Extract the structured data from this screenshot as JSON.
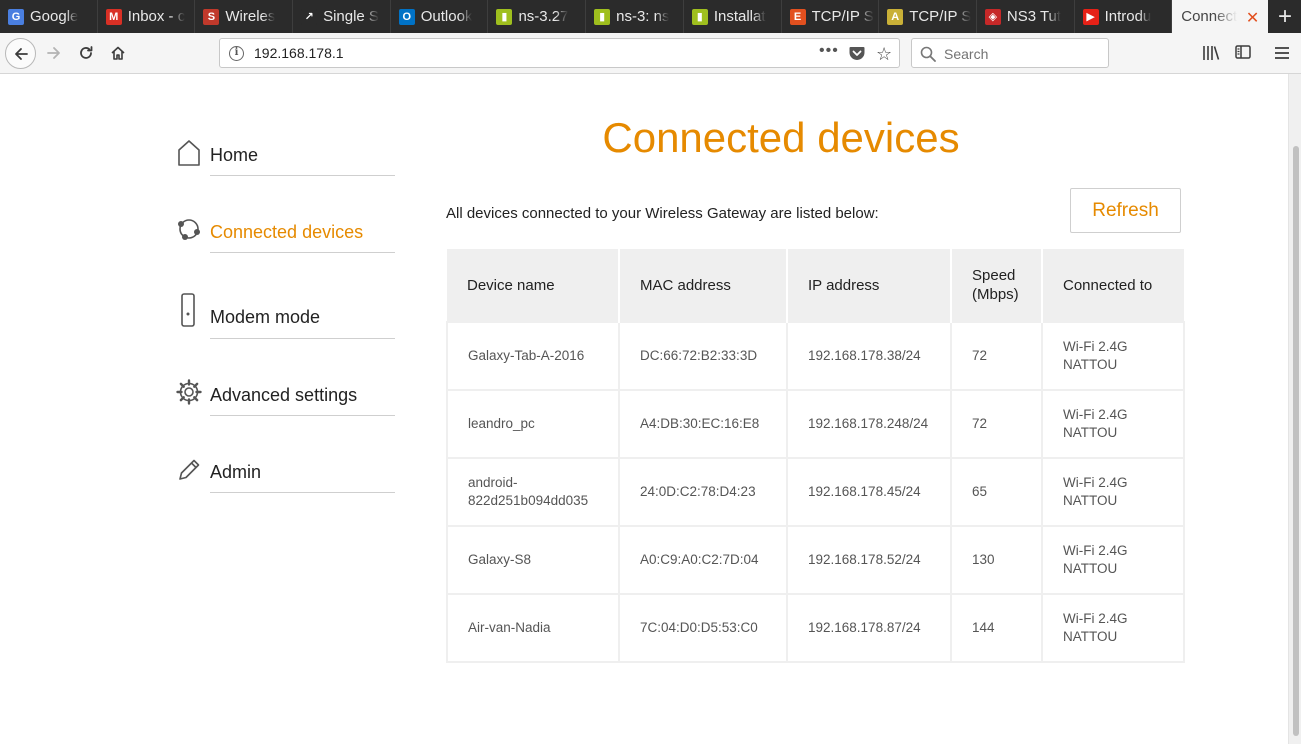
{
  "browser": {
    "tabs": [
      {
        "title": "Google",
        "favicon": "google-translate-icon",
        "color": "#4a7fe0",
        "glyph": "G"
      },
      {
        "title": "Inbox - c",
        "favicon": "gmail-icon",
        "color": "#d93025",
        "glyph": "M"
      },
      {
        "title": "Wireles",
        "favicon": "slideshare-icon",
        "color": "#c0392b",
        "glyph": "S"
      },
      {
        "title": "Single S",
        "favicon": "bird-icon",
        "color": "#2b2b2b",
        "glyph": "↗"
      },
      {
        "title": "Outlook",
        "favicon": "outlook-icon",
        "color": "#0072c6",
        "glyph": "O"
      },
      {
        "title": "ns-3.27",
        "favicon": "ns3-icon",
        "color": "#9fbf1e",
        "glyph": "▮"
      },
      {
        "title": "ns-3: ns",
        "favicon": "ns3-icon",
        "color": "#9fbf1e",
        "glyph": "▮"
      },
      {
        "title": "Installat",
        "favicon": "ns3-icon",
        "color": "#9fbf1e",
        "glyph": "▮"
      },
      {
        "title": "TCP/IP S",
        "favicon": "e-letter-icon",
        "color": "#e2501f",
        "glyph": "E"
      },
      {
        "title": "TCP/IP S",
        "favicon": "a-letter-icon",
        "color": "#c9b037",
        "glyph": "A"
      },
      {
        "title": "NS3 Tut",
        "favicon": "shield-icon",
        "color": "#c62828",
        "glyph": "◈"
      },
      {
        "title": "Introdu",
        "favicon": "youtube-icon",
        "color": "#e62117",
        "glyph": "▶"
      }
    ],
    "active_tab": {
      "title": "Connect",
      "close_glyph": "✕"
    },
    "new_tab_glyph": "+",
    "url": "192.168.178.1",
    "url_info_glyph": "i",
    "url_more_glyph": "•••",
    "bookmark_glyph": "☆",
    "search_placeholder": "Search"
  },
  "sidebar": {
    "items": [
      {
        "label": "Home",
        "icon": "home-icon",
        "active": false
      },
      {
        "label": "Connected devices",
        "icon": "devices-network-icon",
        "active": true
      },
      {
        "label": "Modem mode",
        "icon": "modem-icon",
        "active": false
      },
      {
        "label": "Advanced settings",
        "icon": "gear-icon",
        "active": false
      },
      {
        "label": "Admin",
        "icon": "pencil-icon",
        "active": false
      }
    ]
  },
  "main": {
    "title": "Connected devices",
    "intro": "All devices connected to your Wireless Gateway are listed below:",
    "refresh_label": "Refresh",
    "accent_color": "#e68a00"
  },
  "table": {
    "headers": [
      "Device name",
      "MAC address",
      "IP address",
      "Speed\n(Mbps)",
      "Connected to"
    ],
    "rows": [
      {
        "name": "Galaxy-Tab-A-2016",
        "mac": "DC:66:72:B2:33:3D",
        "ip": "192.168.178.38/24",
        "speed": "72",
        "connected": "Wi-Fi 2.4G\nNATTOU"
      },
      {
        "name": "leandro_pc",
        "mac": "A4:DB:30:EC:16:E8",
        "ip": "192.168.178.248/24",
        "speed": "72",
        "connected": "Wi-Fi 2.4G\nNATTOU"
      },
      {
        "name": "android-\n822d251b094dd035",
        "mac": "24:0D:C2:78:D4:23",
        "ip": "192.168.178.45/24",
        "speed": "65",
        "connected": "Wi-Fi 2.4G\nNATTOU"
      },
      {
        "name": "Galaxy-S8",
        "mac": "A0:C9:A0:C2:7D:04",
        "ip": "192.168.178.52/24",
        "speed": "130",
        "connected": "Wi-Fi 2.4G\nNATTOU"
      },
      {
        "name": "Air-van-Nadia",
        "mac": "7C:04:D0:D5:53:C0",
        "ip": "192.168.178.87/24",
        "speed": "144",
        "connected": "Wi-Fi 2.4G\nNATTOU"
      }
    ]
  }
}
